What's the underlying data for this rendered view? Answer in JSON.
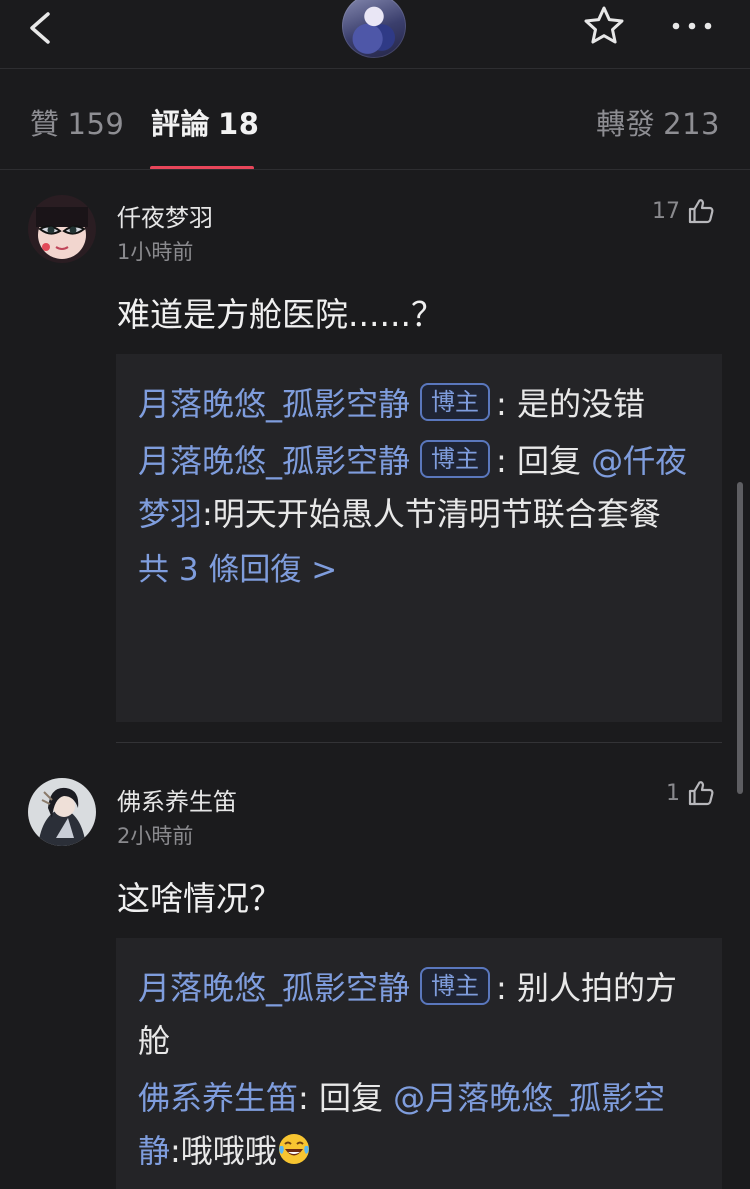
{
  "tabs": {
    "likes": {
      "label": "贊",
      "count": "159"
    },
    "comments": {
      "label": "評論",
      "count": "18"
    },
    "reposts": {
      "label": "轉發",
      "count": "213"
    }
  },
  "comments": [
    {
      "name": "仟夜梦羽",
      "time": "1小時前",
      "likes": "17",
      "body": "难道是方舱医院......？",
      "replies": [
        {
          "user": "月落晚悠_孤影空静",
          "badge": "博主",
          "sep": ": ",
          "text": "是的没错"
        },
        {
          "user": "月落晚悠_孤影空静",
          "badge": "博主",
          "sep": ": ",
          "text_prefix": "回复 ",
          "mention": "@仟夜梦羽",
          "text": ":明天开始愚人节清明节联合套餐"
        }
      ],
      "more": "共 3 條回復 >"
    },
    {
      "name": "佛系养生笛",
      "time": "2小時前",
      "likes": "1",
      "body": "这啥情况？",
      "replies": [
        {
          "user": "月落晚悠_孤影空静",
          "badge": "博主",
          "sep": ": ",
          "text": "别人拍的方舱"
        },
        {
          "user": "佛系养生笛",
          "sep": ": ",
          "text_prefix": "回复 ",
          "mention": "@月落晚悠_孤影空静",
          "text": ":哦哦哦",
          "emoji": "laughing-tears-emoji"
        }
      ]
    }
  ],
  "colors": {
    "background": "#1b1b1d",
    "reply_background": "#242427",
    "link": "#7f9ddd",
    "tab_active_underline": "#e8465a",
    "muted_text": "#8a8a8e"
  },
  "icons": [
    "back-arrow-icon",
    "star-icon",
    "more-dots-icon",
    "thumbs-up-icon"
  ]
}
